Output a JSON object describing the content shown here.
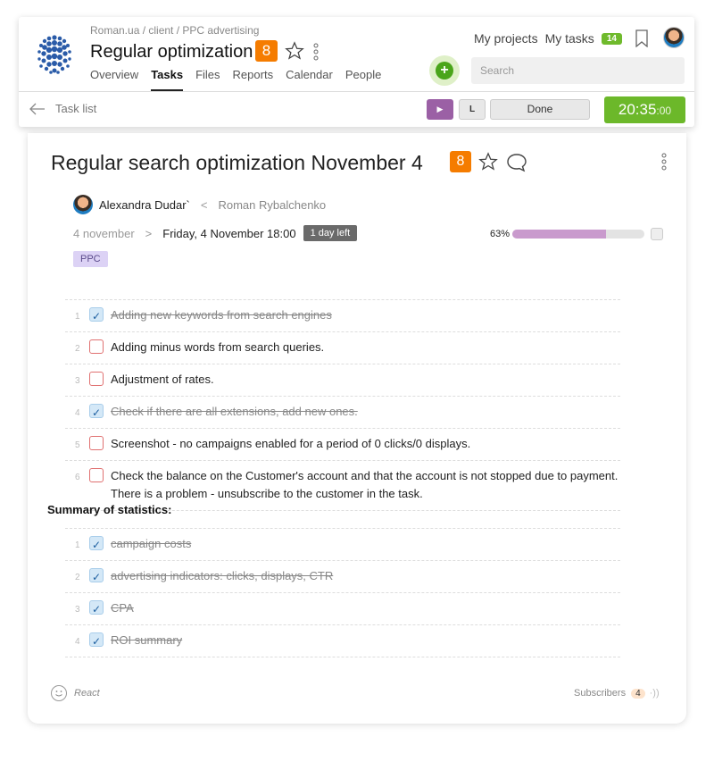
{
  "header": {
    "breadcrumb": "Roman.ua / client / PPC advertising",
    "project_title": "Regular optimization",
    "project_badge": "8",
    "tabs": [
      {
        "label": "Overview",
        "active": false
      },
      {
        "label": "Tasks",
        "active": true
      },
      {
        "label": "Files",
        "active": false
      },
      {
        "label": "Reports",
        "active": false
      },
      {
        "label": "Calendar",
        "active": false
      },
      {
        "label": "People",
        "active": false
      }
    ],
    "my_projects": "My projects",
    "my_tasks": "My tasks",
    "my_tasks_count": "14",
    "search_placeholder": "Search"
  },
  "subbar": {
    "back_label": "Task list",
    "play_label": "▶",
    "l_label": "L",
    "done_label": "Done",
    "timer_main": "20:35",
    "timer_sec": ":00"
  },
  "task": {
    "title": "Regular search optimization November 4",
    "badge": "8",
    "assignee": "Alexandra Dudar`",
    "lt": "<",
    "creator": "Roman Rybalchenko",
    "date_from": "4 november",
    "gt": ">",
    "date_to": "Friday, 4 November 18:00",
    "days_left": "1 day left",
    "progress_label": "63%",
    "progress_value": 0.71,
    "tag": "PPC"
  },
  "checklist": [
    {
      "num": "1",
      "done": true,
      "text": "Adding new keywords from search engines"
    },
    {
      "num": "2",
      "done": false,
      "text": "Adding minus words from search queries."
    },
    {
      "num": "3",
      "done": false,
      "text": "Adjustment of rates."
    },
    {
      "num": "4",
      "done": true,
      "text": "Check if there are all extensions, add new ones."
    },
    {
      "num": "5",
      "done": false,
      "text": "Screenshot - no campaigns enabled for a period of 0 clicks/0 displays."
    },
    {
      "num": "6",
      "done": false,
      "text": "Check the balance on the Customer's account and that the account is not stopped due to payment. There is a problem - unsubscribe to the customer in the task."
    }
  ],
  "summary_title": "Summary of statistics:",
  "summary_list": [
    {
      "num": "1",
      "done": true,
      "text": "campaign costs"
    },
    {
      "num": "2",
      "done": true,
      "text": "advertising indicators: clicks, displays, CTR"
    },
    {
      "num": "3",
      "done": true,
      "text": "CPA"
    },
    {
      "num": "4",
      "done": true,
      "text": "ROI summary"
    }
  ],
  "footer": {
    "react_label": "React",
    "subscribers_label": "Subscribers",
    "subscribers_count": "4",
    "wave": "·))"
  },
  "colors": {
    "accent_orange": "#f57c00",
    "accent_green": "#6cb82a",
    "play_purple": "#9b60a5",
    "progress_fill": "#c99acd",
    "tag_bg": "#dcd2f5"
  }
}
